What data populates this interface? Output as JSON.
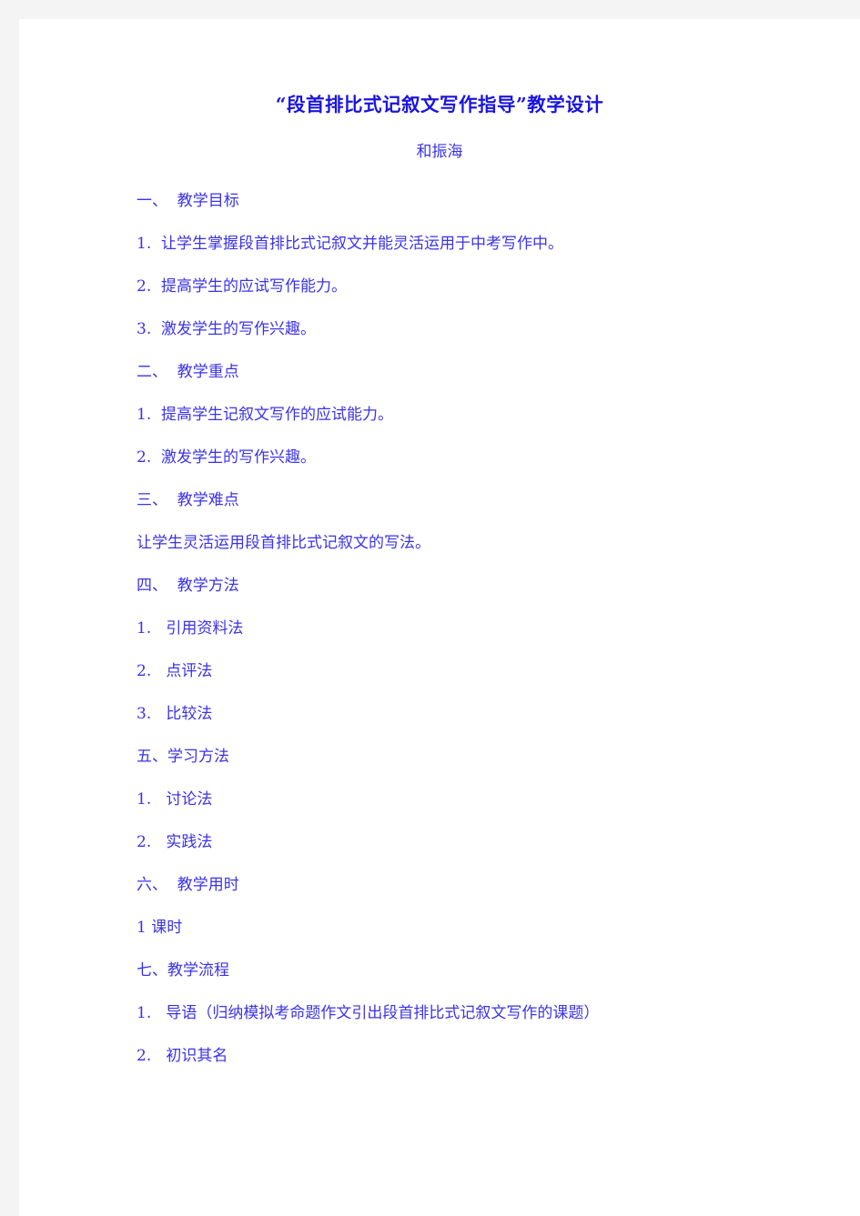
{
  "document": {
    "title": "“段首排比式记叙文写作指导”教学设计",
    "byline": "和振海",
    "text_color": "#3b33e8",
    "title_color": "#1a14e0",
    "page_background": "#ffffff",
    "canvas_background": "#f4f4f5",
    "lines": [
      {
        "text": "一、  教学目标",
        "kind": "heading"
      },
      {
        "text": "1.  让学生掌握段首排比式记叙文并能灵活运用于中考写作中。",
        "kind": "item"
      },
      {
        "text": "2.  提高学生的应试写作能力。",
        "kind": "item"
      },
      {
        "text": "3.  激发学生的写作兴趣。",
        "kind": "item"
      },
      {
        "text": "二、  教学重点",
        "kind": "heading"
      },
      {
        "text": "1.  提高学生记叙文写作的应试能力。",
        "kind": "item"
      },
      {
        "text": "2.  激发学生的写作兴趣。",
        "kind": "item"
      },
      {
        "text": "三、  教学难点",
        "kind": "heading"
      },
      {
        "text": "让学生灵活运用段首排比式记叙文的写法。",
        "kind": "item"
      },
      {
        "text": "四、  教学方法",
        "kind": "heading"
      },
      {
        "text": "1.   引用资料法",
        "kind": "item"
      },
      {
        "text": "2.   点评法",
        "kind": "item"
      },
      {
        "text": "3.   比较法",
        "kind": "item"
      },
      {
        "text": "五、学习方法",
        "kind": "heading"
      },
      {
        "text": "1.   讨论法",
        "kind": "item"
      },
      {
        "text": "2.   实践法",
        "kind": "item"
      },
      {
        "text": "六、  教学用时",
        "kind": "heading"
      },
      {
        "text": "1 课时",
        "kind": "item"
      },
      {
        "text": "七、教学流程",
        "kind": "heading"
      },
      {
        "text": "1.   导语（归纳模拟考命题作文引出段首排比式记叙文写作的课题）",
        "kind": "item"
      },
      {
        "text": "2.   初识其名",
        "kind": "item"
      }
    ]
  }
}
